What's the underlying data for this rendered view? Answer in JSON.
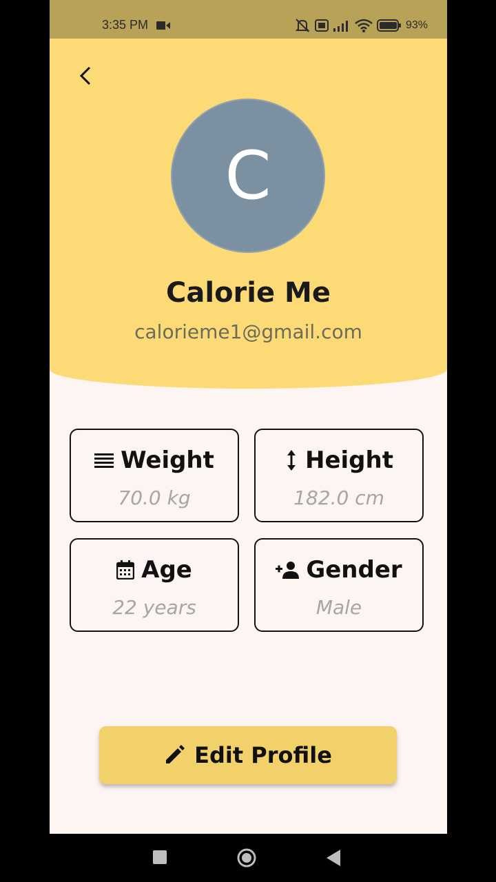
{
  "status_bar": {
    "time": "3:35 PM",
    "battery": "93%"
  },
  "header": {
    "avatar_letter": "C",
    "name": "Calorie Me",
    "email": "calorieme1@gmail.com"
  },
  "stats": {
    "weight": {
      "label": "Weight",
      "value": "70.0 kg",
      "icon": "list-lines-icon"
    },
    "height": {
      "label": "Height",
      "value": "182.0 cm",
      "icon": "vertical-arrows-icon"
    },
    "age": {
      "label": "Age",
      "value": "22 years",
      "icon": "calendar-icon"
    },
    "gender": {
      "label": "Gender",
      "value": "Male",
      "icon": "person-add-icon"
    }
  },
  "actions": {
    "edit_profile_label": "Edit Profile"
  },
  "colors": {
    "header_bg": "#fcdb76",
    "page_bg": "#fcf5f2",
    "button_bg": "#f2d16a",
    "avatar_bg": "#7b90a1"
  }
}
